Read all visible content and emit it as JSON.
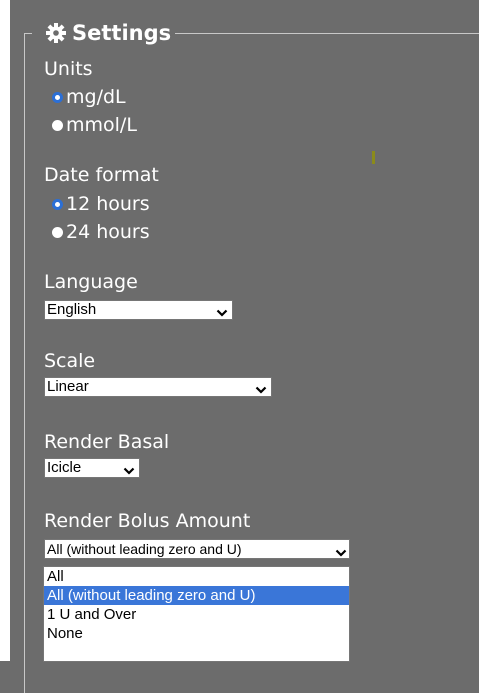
{
  "settings": {
    "title": "Settings",
    "icon": "gear-icon"
  },
  "units": {
    "label": "Units",
    "options": [
      "mg/dL",
      "mmol/L"
    ],
    "selected": "mg/dL"
  },
  "date_format": {
    "label": "Date format",
    "options": [
      "12 hours",
      "24 hours"
    ],
    "selected": "12 hours"
  },
  "language": {
    "label": "Language",
    "value": "English"
  },
  "scale": {
    "label": "Scale",
    "value": "Linear"
  },
  "render_basal": {
    "label": "Render Basal",
    "value": "Icicle"
  },
  "render_bolus": {
    "label": "Render Bolus Amount",
    "value": "All (without leading zero and U)",
    "options": [
      "All",
      "All (without leading zero and U)",
      "1 U and Over",
      "None"
    ],
    "highlighted": "All (without leading zero and U)"
  },
  "colors": {
    "background": "#6c6c6c",
    "radio_accent": "#2b6fd6",
    "option_highlight": "#3a76d8"
  }
}
